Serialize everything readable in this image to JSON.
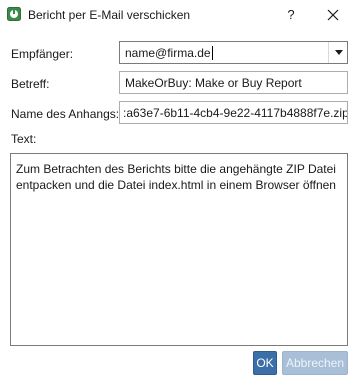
{
  "window": {
    "title": "Bericht per E-Mail verschicken",
    "help_label": "?"
  },
  "form": {
    "recipient": {
      "label": "Empfänger:",
      "value": "name@firma.de"
    },
    "subject": {
      "label": "Betreff:",
      "value": "MakeOrBuy: Make or Buy Report"
    },
    "attachment": {
      "label": "Name des Anhangs:",
      "value": ":a63e7-6b11-4cb4-9e22-4117b4888f7e.zip"
    },
    "text": {
      "label": "Text:",
      "value": "Zum Betrachten des Berichts bitte die angehängte ZIP Datei entpacken und die Datei index.html in einem Browser öffnen"
    }
  },
  "buttons": {
    "ok_label": "OK",
    "cancel_label": "Abbrechen"
  },
  "colors": {
    "app_icon": "#3c8a4b",
    "primary_button": "#3b6fa8",
    "disabled_button": "#a9bfd8"
  }
}
